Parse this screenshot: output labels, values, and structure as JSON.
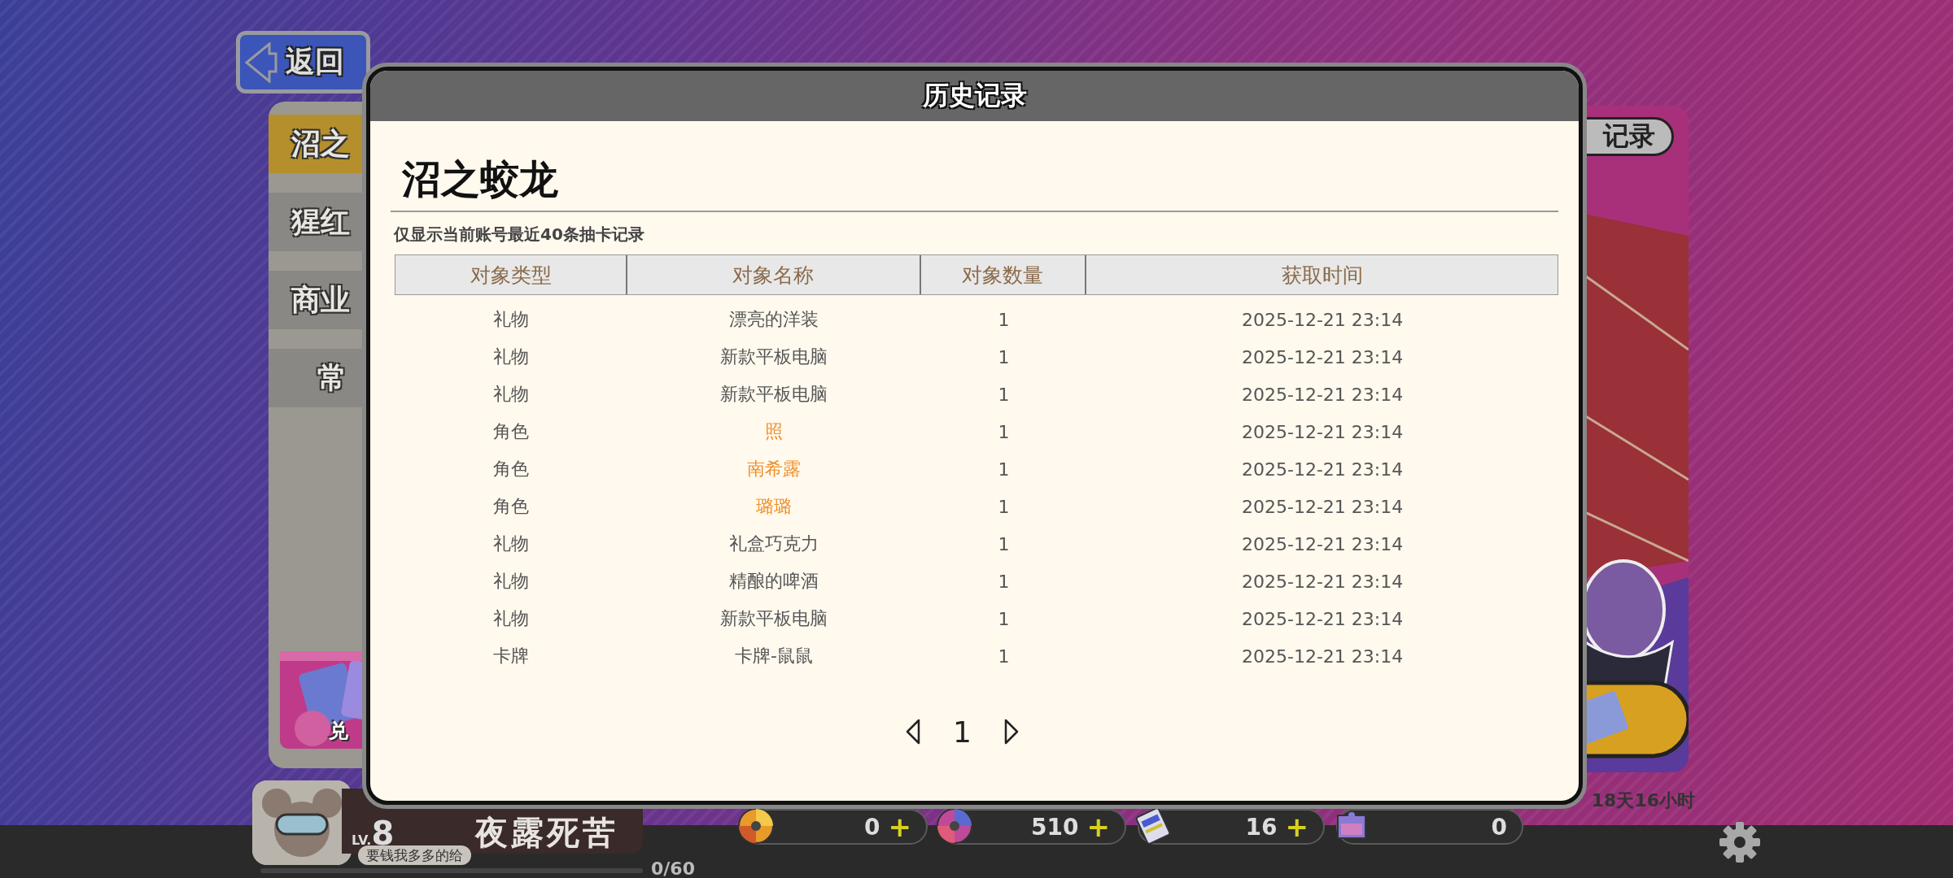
{
  "back_button": {
    "label": "返回"
  },
  "side_tabs": [
    {
      "label": "沼之",
      "selected": true
    },
    {
      "label": "猩红",
      "selected": false
    },
    {
      "label": "商业",
      "selected": false
    },
    {
      "label": "常",
      "selected": false
    }
  ],
  "exchange_banner": {
    "label": "兑"
  },
  "right_panel": {
    "tab_label": "记录",
    "countdown": "18天16小时"
  },
  "player": {
    "level_prefix": "LV.",
    "level": "8",
    "name": "夜露死苦",
    "motto": "要钱我多多的给",
    "exp": "0/60"
  },
  "currencies": [
    {
      "amount": "0",
      "plus": "+"
    },
    {
      "amount": "510",
      "plus": "+"
    },
    {
      "amount": "16",
      "plus": "+"
    },
    {
      "amount": "0"
    }
  ],
  "modal": {
    "title": "历史记录",
    "pool_name": "沼之蛟龙",
    "note": "仅显示当前账号最近40条抽卡记录",
    "columns": [
      "对象类型",
      "对象名称",
      "对象数量",
      "获取时间"
    ],
    "rows": [
      {
        "type": "礼物",
        "name": "漂亮的洋装",
        "count": "1",
        "time": "2025-12-21 23:14",
        "highlight": false
      },
      {
        "type": "礼物",
        "name": "新款平板电脑",
        "count": "1",
        "time": "2025-12-21 23:14",
        "highlight": false
      },
      {
        "type": "礼物",
        "name": "新款平板电脑",
        "count": "1",
        "time": "2025-12-21 23:14",
        "highlight": false
      },
      {
        "type": "角色",
        "name": "照",
        "count": "1",
        "time": "2025-12-21 23:14",
        "highlight": true
      },
      {
        "type": "角色",
        "name": "南希露",
        "count": "1",
        "time": "2025-12-21 23:14",
        "highlight": true
      },
      {
        "type": "角色",
        "name": "璐璐",
        "count": "1",
        "time": "2025-12-21 23:14",
        "highlight": true
      },
      {
        "type": "礼物",
        "name": "礼盒巧克力",
        "count": "1",
        "time": "2025-12-21 23:14",
        "highlight": false
      },
      {
        "type": "礼物",
        "name": "精酿的啤酒",
        "count": "1",
        "time": "2025-12-21 23:14",
        "highlight": false
      },
      {
        "type": "礼物",
        "name": "新款平板电脑",
        "count": "1",
        "time": "2025-12-21 23:14",
        "highlight": false
      },
      {
        "type": "卡牌",
        "name": "卡牌-鼠鼠",
        "count": "1",
        "time": "2025-12-21 23:14",
        "highlight": false
      }
    ],
    "page": "1"
  }
}
